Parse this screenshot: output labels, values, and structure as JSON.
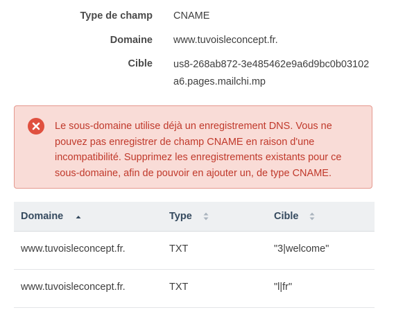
{
  "record": {
    "type_label": "Type de champ",
    "type_value": "CNAME",
    "domain_label": "Domaine",
    "domain_value": "www.tuvoisleconcept.fr.",
    "target_label": "Cible",
    "target_value_line1": "us8-268ab872-3e485462e9a6d9bc0b03102",
    "target_value_line2": "a6.pages.mailchi.mp"
  },
  "alert": {
    "icon": "error-x-circle-icon",
    "message": "Le sous-domaine utilise déjà un enregistrement DNS. Vous ne pouvez pas enregistrer de champ CNAME en raison d'une incompatibilité. Supprimez les enregistrements existants pour ce sous-domaine, afin de pouvoir en ajouter un, de type CNAME.",
    "colors": {
      "background": "#f9dcd7",
      "border": "#e5988e",
      "text": "#c0392b",
      "icon": "#e0503f"
    }
  },
  "table": {
    "columns": [
      {
        "label": "Domaine",
        "sort": "ascending"
      },
      {
        "label": "Type",
        "sort": "none"
      },
      {
        "label": "Cible",
        "sort": "none"
      }
    ],
    "rows": [
      {
        "domain": "www.tuvoisleconcept.fr.",
        "type": "TXT",
        "target": "\"3|welcome\""
      },
      {
        "domain": "www.tuvoisleconcept.fr.",
        "type": "TXT",
        "target": "\"l|fr\""
      }
    ]
  }
}
